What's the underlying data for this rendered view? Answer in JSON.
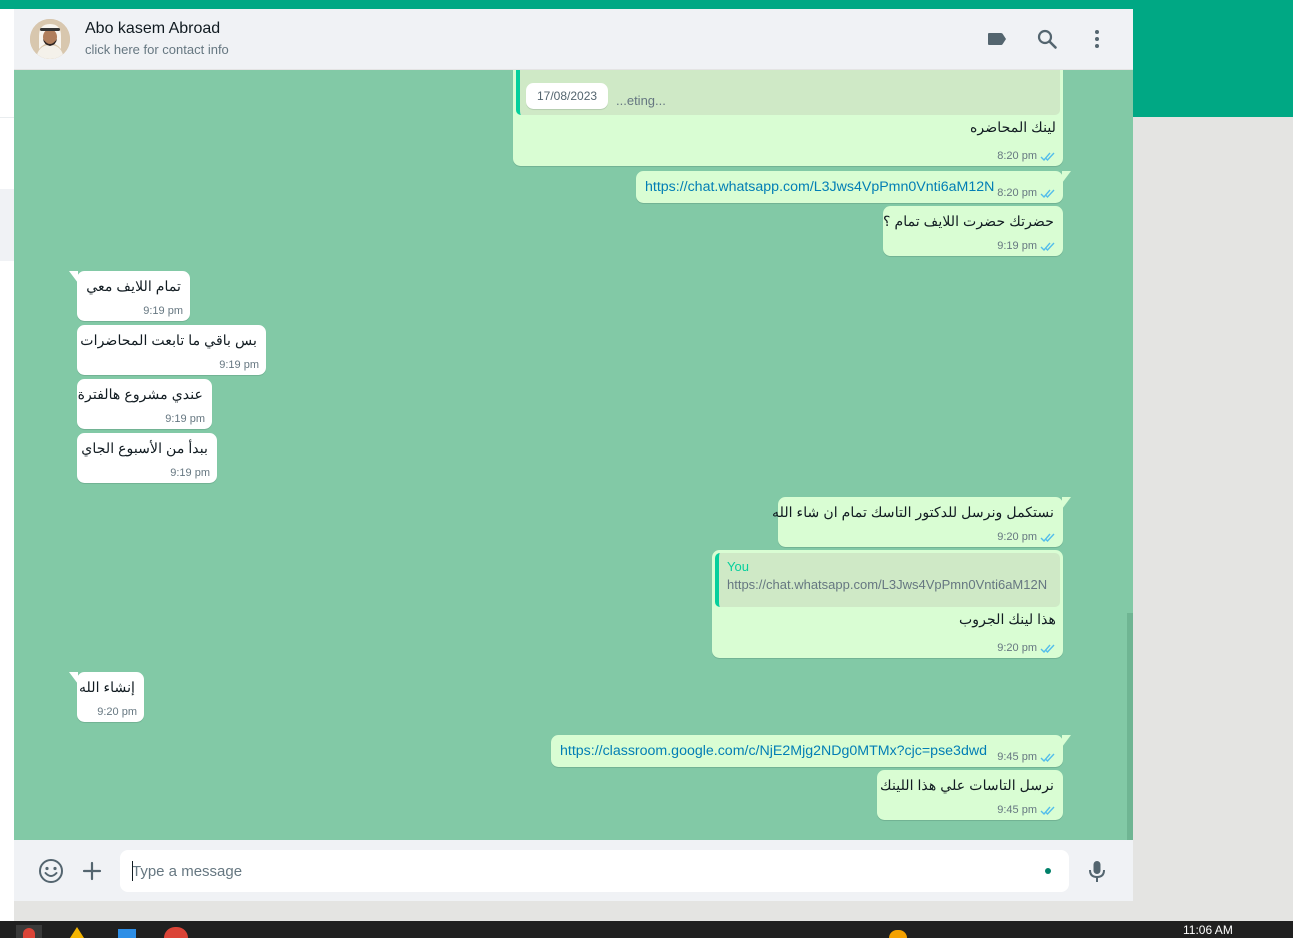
{
  "contact": {
    "name": "Abo kasem Abroad",
    "subtitle": "click here for contact info"
  },
  "header_icons": [
    "label-icon",
    "search-icon",
    "menu-icon"
  ],
  "date_chip": "17/08/2023",
  "messages": [
    {
      "dir": "out",
      "quote_text": "...eting...",
      "text": "لينك المحاضره",
      "time": "8:20 pm"
    },
    {
      "dir": "out",
      "text": "https://chat.whatsapp.com/L3Jws4VpPmn0Vnti6aM12N",
      "time": "8:20 pm",
      "link": true
    },
    {
      "dir": "out",
      "text": "حضرتك حضرت اللايف تمام ؟",
      "time": "9:19 pm"
    },
    {
      "dir": "in",
      "text": "تمام اللايف معي",
      "time": "9:19 pm"
    },
    {
      "dir": "in",
      "text": "بس باقي ما تابعت المحاضرات",
      "time": "9:19 pm"
    },
    {
      "dir": "in",
      "text": "عندي مشروع هالفترة",
      "time": "9:19 pm"
    },
    {
      "dir": "in",
      "text": "ببدأ من الأسبوع الجاي",
      "time": "9:19 pm"
    },
    {
      "dir": "out",
      "text": "نستكمل ونرسل للدكتور التاسك تمام ان شاء الله",
      "time": "9:20 pm"
    },
    {
      "dir": "out",
      "quote_name": "You",
      "quote_text": "https://chat.whatsapp.com/L3Jws4VpPmn0Vnti6aM12N",
      "text": "هذا لينك الجروب",
      "time": "9:20 pm"
    },
    {
      "dir": "in",
      "text": "إنشاء الله",
      "time": "9:20 pm"
    },
    {
      "dir": "out",
      "text": "https://classroom.google.com/c/NjE2Mjg2NDg0MTMx?cjc=pse3dwd",
      "time": "9:45 pm",
      "link": true
    },
    {
      "dir": "out",
      "text": "نرسل التاسات علي هذا اللينك",
      "time": "9:45 pm"
    }
  ],
  "composer": {
    "placeholder": "Type a message",
    "icons": [
      "emoji-icon",
      "plus-icon",
      "microphone-icon"
    ]
  },
  "taskbar": {
    "clock": "11:06 AM"
  },
  "colors": {
    "brand": "#00a884",
    "chat_bg": "#82c9a6",
    "outgoing": "#d9fdd3",
    "incoming": "#ffffff",
    "link": "#027eb5",
    "read_ticks": "#53bdeb"
  }
}
